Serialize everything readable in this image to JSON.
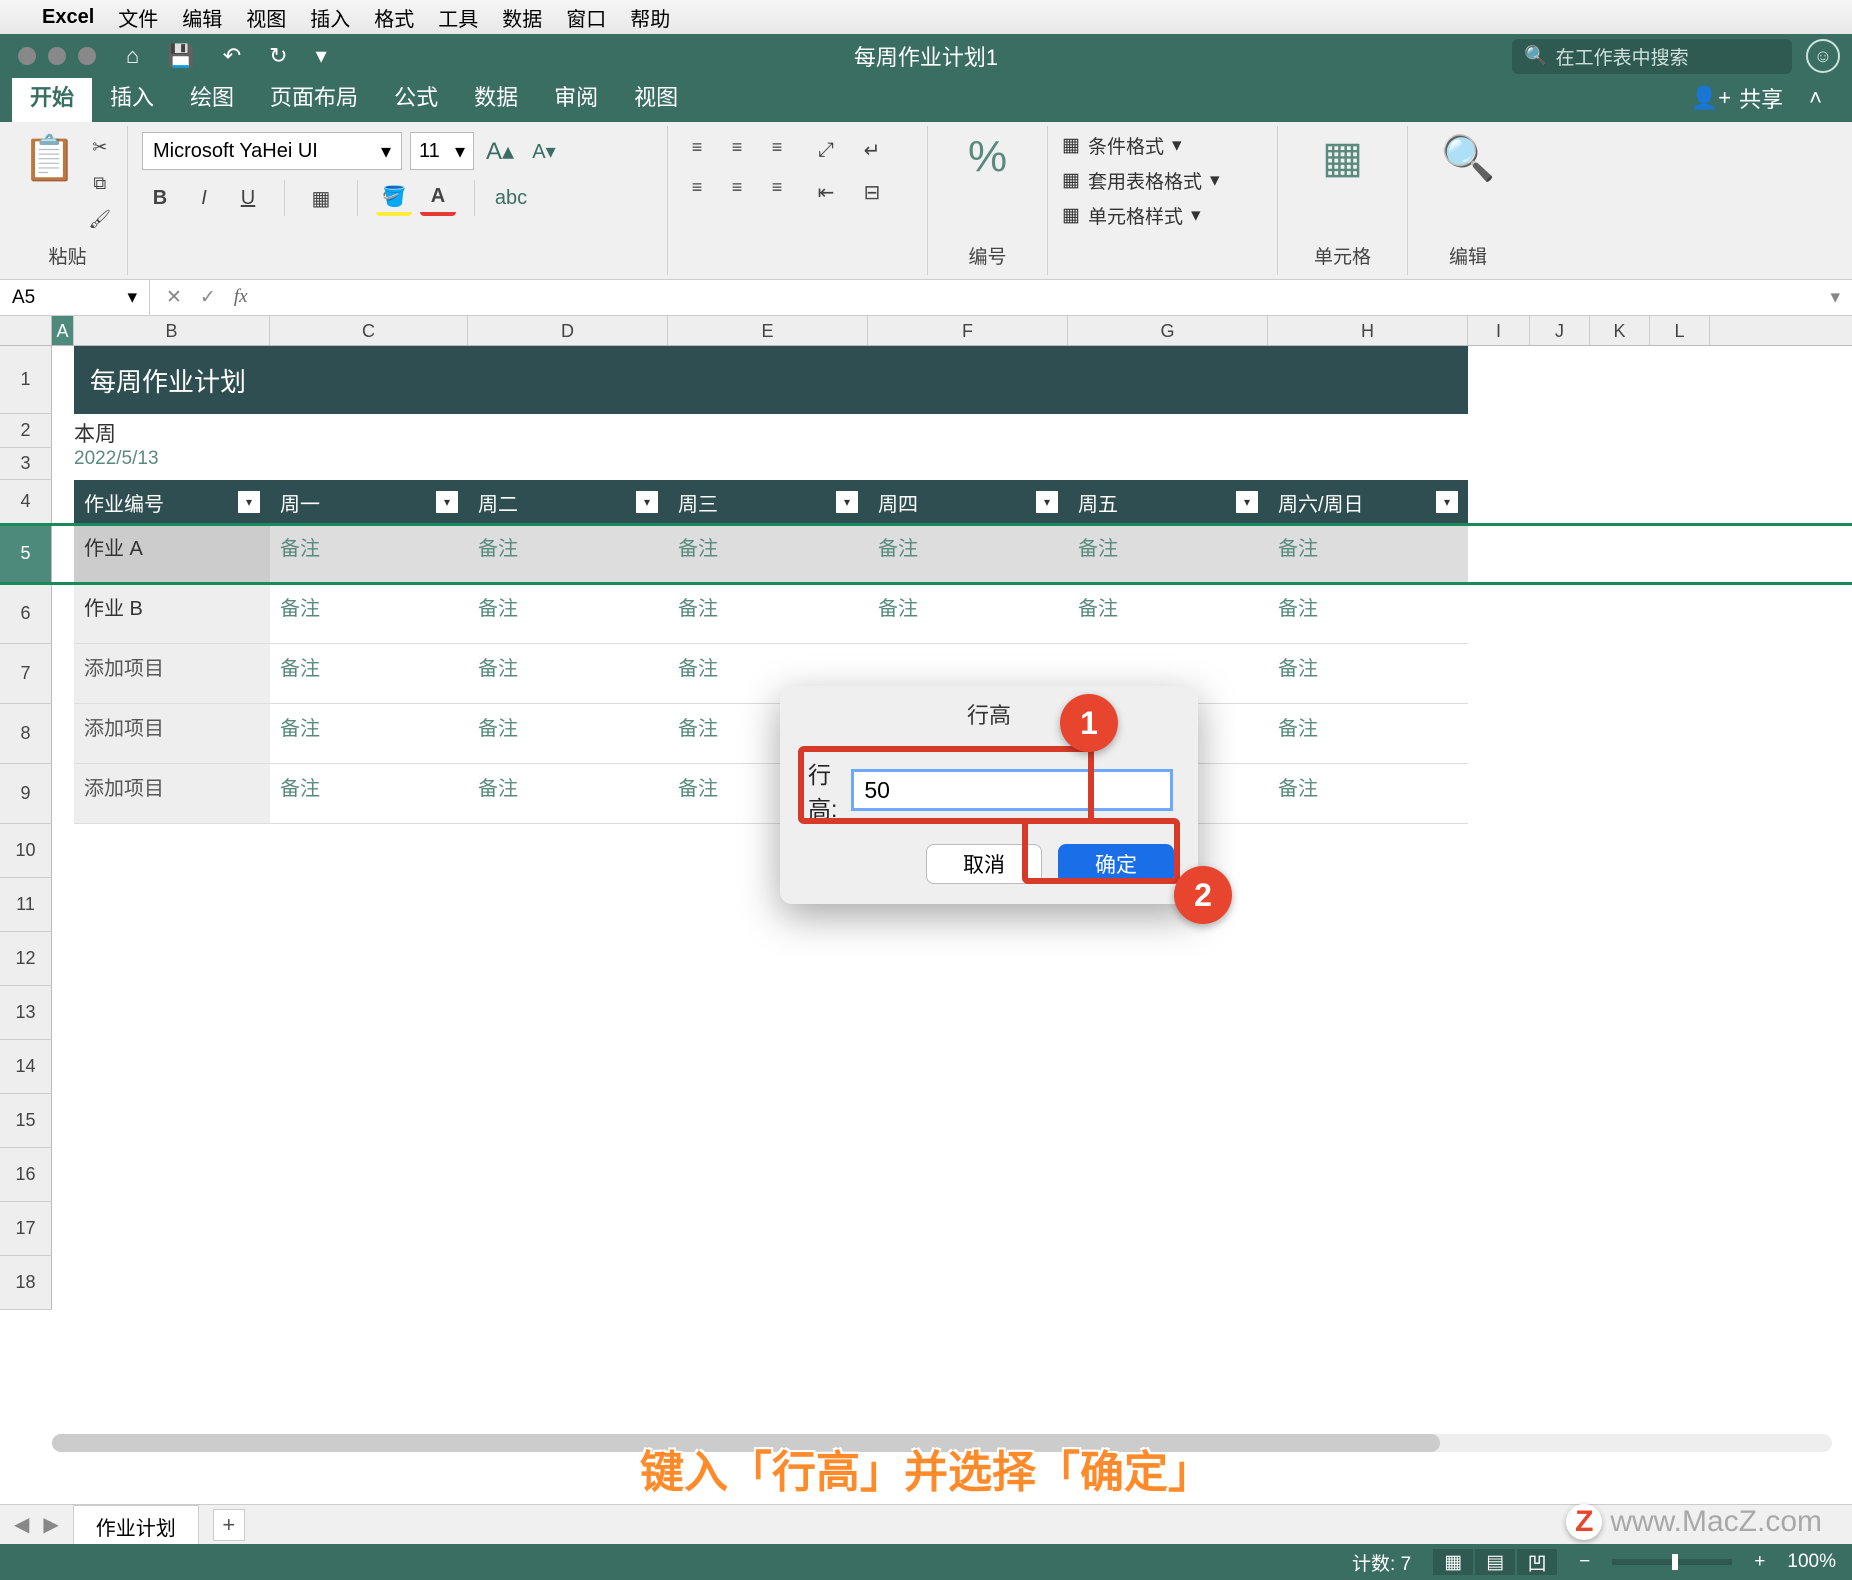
{
  "mac_menu": {
    "app": "Excel",
    "items": [
      "文件",
      "编辑",
      "视图",
      "插入",
      "格式",
      "工具",
      "数据",
      "窗口",
      "帮助"
    ]
  },
  "titlebar": {
    "title": "每周作业计划1",
    "search_placeholder": "在工作表中搜索"
  },
  "ribbon_tabs": {
    "active": "开始",
    "tabs": [
      "开始",
      "插入",
      "绘图",
      "页面布局",
      "公式",
      "数据",
      "审阅",
      "视图"
    ],
    "share": "共享"
  },
  "ribbon": {
    "paste": "粘贴",
    "font_name": "Microsoft YaHei UI",
    "font_size": "11",
    "number_group": "编号",
    "styles": {
      "cond": "条件格式",
      "table": "套用表格格式",
      "cell": "单元格样式"
    },
    "cells_group": "单元格",
    "edit_group": "编辑"
  },
  "formula_bar": {
    "cell_ref": "A5"
  },
  "columns": [
    "A",
    "B",
    "C",
    "D",
    "E",
    "F",
    "G",
    "H",
    "I",
    "J",
    "K",
    "L"
  ],
  "rows": [
    "1",
    "2",
    "3",
    "4",
    "5",
    "6",
    "7",
    "8",
    "9",
    "10",
    "11",
    "12",
    "13",
    "14",
    "15",
    "16",
    "17",
    "18"
  ],
  "sheet": {
    "title": "每周作业计划",
    "subtitle": "本周",
    "date": "2022/5/13",
    "headers": [
      "作业编号",
      "周一",
      "周二",
      "周三",
      "周四",
      "周五",
      "周六/周日"
    ],
    "note_text": "备注",
    "rows": [
      {
        "id": "作业 A",
        "selected": true
      },
      {
        "id": "作业 B"
      },
      {
        "id": "添加项目",
        "add": true
      },
      {
        "id": "添加项目",
        "add": true
      },
      {
        "id": "添加项目",
        "add": true
      }
    ]
  },
  "dialog": {
    "title": "行高",
    "label": "行高:",
    "value": "50",
    "cancel": "取消",
    "ok": "确定"
  },
  "annotations": {
    "n1": "1",
    "n2": "2"
  },
  "caption": "键入「行高」并选择「确定」",
  "sheet_tabs": {
    "active": "作业计划"
  },
  "status": {
    "count_label": "计数:",
    "count": "7",
    "zoom": "100%"
  },
  "watermark": "www.MacZ.com"
}
